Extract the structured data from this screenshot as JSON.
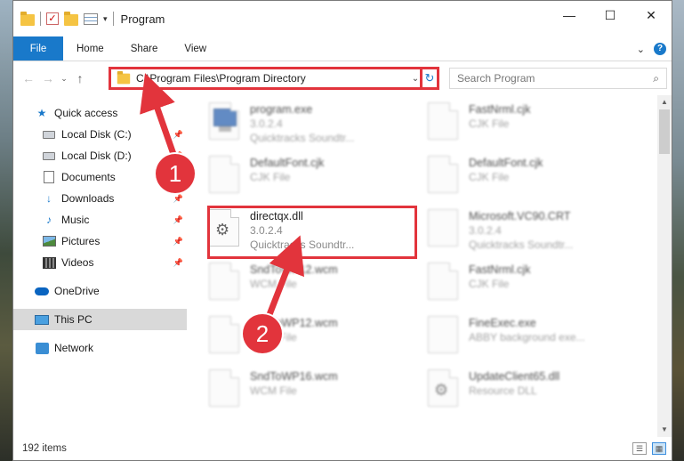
{
  "window": {
    "title": "Program",
    "controls": {
      "minimize": "—",
      "maximize": "☐",
      "close": "✕"
    }
  },
  "ribbon": {
    "tabs": [
      {
        "label": "File"
      },
      {
        "label": "Home"
      },
      {
        "label": "Share"
      },
      {
        "label": "View"
      }
    ],
    "expand": "⌄",
    "help": "?"
  },
  "nav": {
    "back": "←",
    "forward": "→",
    "recent": "⌄",
    "up": "↑"
  },
  "address": {
    "path": "C:\\Program Files\\Program Directory",
    "dropdown": "⌄",
    "refresh": "↻"
  },
  "search": {
    "placeholder": "Search Program",
    "icon": "⌕"
  },
  "sidebar": {
    "items": [
      {
        "label": "Quick access",
        "icon": "star-icon",
        "pinned": false
      },
      {
        "label": "Local Disk (C:)",
        "icon": "drive-icon",
        "pinned": true
      },
      {
        "label": "Local Disk (D:)",
        "icon": "drive-icon",
        "pinned": true
      },
      {
        "label": "Documents",
        "icon": "documents-icon",
        "pinned": true
      },
      {
        "label": "Downloads",
        "icon": "download-icon",
        "pinned": true
      },
      {
        "label": "Music",
        "icon": "music-icon",
        "pinned": true
      },
      {
        "label": "Pictures",
        "icon": "pictures-icon",
        "pinned": true
      },
      {
        "label": "Videos",
        "icon": "videos-icon",
        "pinned": true
      },
      {
        "label": "OneDrive",
        "icon": "cloud-icon"
      },
      {
        "label": "This PC",
        "icon": "pc-icon",
        "selected": true
      },
      {
        "label": "Network",
        "icon": "network-icon"
      }
    ]
  },
  "files": [
    {
      "name": "program.exe",
      "line1": "3.0.2.4",
      "line2": "Quicktracks Soundtr..."
    },
    {
      "name": "FastNrml.cjk",
      "line1": "CJK File",
      "line2": ""
    },
    {
      "name": "DefaultFont.cjk",
      "line1": "CJK File",
      "line2": ""
    },
    {
      "name": "DefaultFont.cjk",
      "line1": "CJK File",
      "line2": ""
    },
    {
      "name": "directqx.dll",
      "line1": "3.0.2.4",
      "line2": "Quicktracks Soundtr..."
    },
    {
      "name": "Microsoft.VC90.CRT",
      "line1": "3.0.2.4",
      "line2": "Quicktracks Soundtr..."
    },
    {
      "name": "SndToWP12.wcm",
      "line1": "WCM File",
      "line2": ""
    },
    {
      "name": "FastNrml.cjk",
      "line1": "CJK File",
      "line2": ""
    },
    {
      "name": "SndToWP12.wcm",
      "line1": "WCM File",
      "line2": ""
    },
    {
      "name": "FineExec.exe",
      "line1": "ABBY background exe...",
      "line2": ""
    },
    {
      "name": "SndToWP16.wcm",
      "line1": "WCM File",
      "line2": ""
    },
    {
      "name": "UpdateClient65.dll",
      "line1": "Resource DLL",
      "line2": ""
    }
  ],
  "status": {
    "count": "192 items"
  },
  "annotations": {
    "step1": "1",
    "step2": "2",
    "color": "#e2343c"
  }
}
